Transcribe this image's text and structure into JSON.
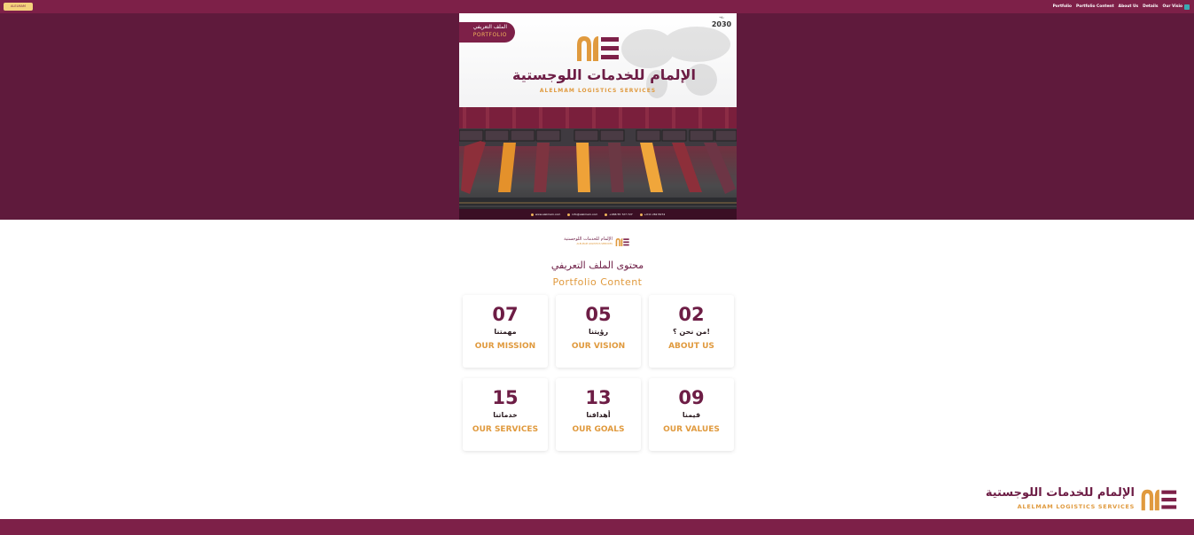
{
  "header": {
    "brand_chip": "ALELMAM",
    "nav": [
      "Portfolio",
      "Portfolio Content",
      "About Us",
      "Details",
      "Our Visio"
    ]
  },
  "cover": {
    "tag_ar": "الملف التعريفي",
    "tag_en": "PORTFOLIO",
    "vision_label": "رؤية",
    "vision_number": "2030",
    "title_ar": "الإلمام للخدمات اللوجستية",
    "title_en": "ALELMAM LOGISTICS SERVICES",
    "footer": [
      "www.alelmam.com",
      "info@alelmam.com",
      "+966 55 727 727",
      "+011 262 8274"
    ]
  },
  "mini_logo": {
    "ar": "الإلمام للخدمات اللوجستية",
    "en": "ALELMAM LOGISTICS SERVICES"
  },
  "section": {
    "title_ar": "محتوى الملف التعريفي",
    "title_en": "Portfolio Content"
  },
  "cards": [
    {
      "num": "07",
      "ar": "مهمتنا",
      "en": "OUR MISSION"
    },
    {
      "num": "05",
      "ar": "رؤيتنا",
      "en": "OUR VISION"
    },
    {
      "num": "02",
      "ar": "من نحن ؟!",
      "en": "ABOUT US"
    },
    {
      "num": "15",
      "ar": "خدماتنا",
      "en": "OUR SERVICES"
    },
    {
      "num": "13",
      "ar": "أهدافنا",
      "en": "OUR GOALS"
    },
    {
      "num": "09",
      "ar": "قيمنا",
      "en": "OUR VALUES"
    }
  ],
  "footer_logo": {
    "ar": "الإلمام للخدمات اللوجستية",
    "en": "ALELMAM LOGISTICS SERVICES"
  },
  "colors": {
    "brand": "#7d2048",
    "hero": "#5f1a3c",
    "accent": "#e09a3e",
    "title": "#6d1d45"
  }
}
